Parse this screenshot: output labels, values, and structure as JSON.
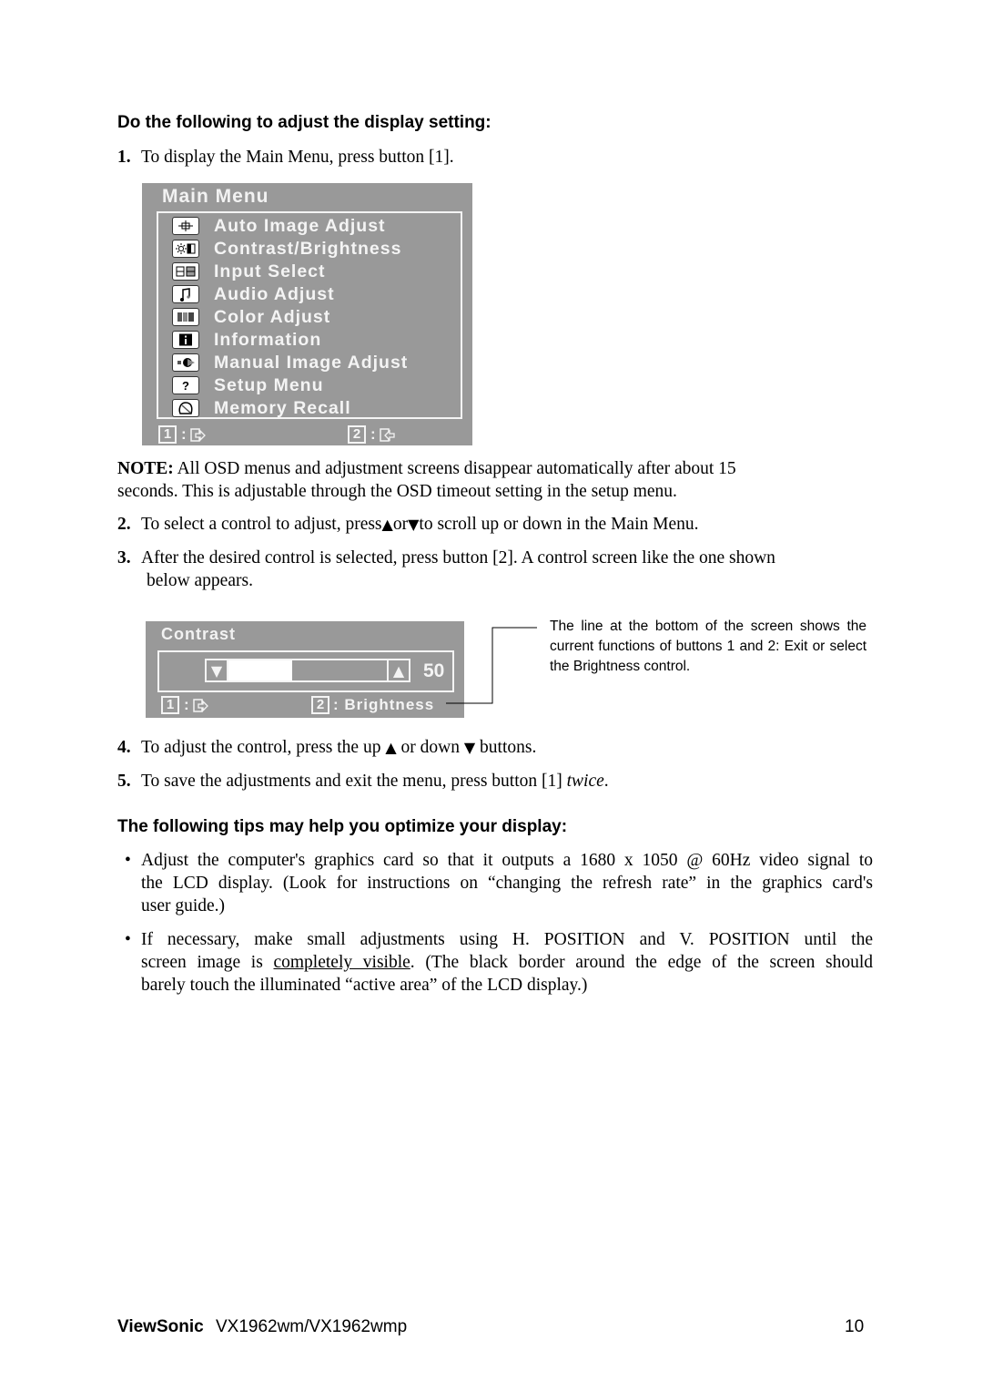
{
  "section_heading": "Do the following to adjust the display setting:",
  "steps": [
    {
      "num": "1.",
      "text": "To display the Main Menu, press button [1]."
    },
    {
      "num": "2.",
      "text_before": "To select a control to adjust, press",
      "up_symbol": "▲",
      "mid": "or",
      "down_symbol": "▼",
      "text_after": "to scroll up or down in the Main Menu."
    },
    {
      "num": "3.",
      "line1": "After the desired control is selected, press button [2]. A control screen like the one shown",
      "line2": "below appears."
    },
    {
      "num": "4.",
      "text_before": "To adjust the control, press the up",
      "up_symbol": "▲",
      "mid": "or down",
      "down_symbol": "▼",
      "text_after": "buttons."
    },
    {
      "num": "5.",
      "text": "To save the adjustments and exit the menu, press button [1]",
      "emphasis": "twice",
      "end": "."
    }
  ],
  "note": {
    "label": "NOTE:",
    "line1": "All OSD menus and adjustment screens disappear automatically after about 15",
    "line2": "seconds. This is adjustable through the OSD timeout setting in the setup menu."
  },
  "main_menu": {
    "title": "Main Menu",
    "items": [
      {
        "label": "Auto Image Adjust",
        "icon": "crosshair-icon",
        "glyph": "✥"
      },
      {
        "label": "Contrast/Brightness",
        "icon": "brightness-icon",
        "glyph": "☼▐"
      },
      {
        "label": "Input Select",
        "icon": "input-select-icon",
        "glyph": "⊟⊟"
      },
      {
        "label": "Audio Adjust",
        "icon": "music-note-icon",
        "glyph": "♫"
      },
      {
        "label": "Color Adjust",
        "icon": "color-bars-icon",
        "glyph": "▮▮"
      },
      {
        "label": "Information",
        "icon": "info-icon",
        "glyph": "i"
      },
      {
        "label": "Manual Image Adjust",
        "icon": "wrench-icon",
        "glyph": "▪◐"
      },
      {
        "label": "Setup Menu",
        "icon": "question-icon",
        "glyph": "?"
      },
      {
        "label": "Memory Recall",
        "icon": "memory-recall-icon",
        "glyph": "◯"
      }
    ],
    "footer": {
      "key1": "1",
      "sep": ":",
      "key2": "2"
    }
  },
  "contrast_screen": {
    "title": "Contrast",
    "value": "50",
    "level_percent": 50,
    "down_symbol": "▼",
    "up_symbol": "▲",
    "footer": {
      "key1": "1",
      "sep": ":",
      "key2": "2",
      "key2_label": ": Brightness"
    }
  },
  "callout_text": "The line at the bottom of the screen shows the current functions of buttons 1 and 2: Exit or select the Brightness control.",
  "tips_heading": "The following tips may help you optimize your display:",
  "tips": [
    {
      "bullet": "•",
      "line1": "Adjust the computer's graphics card so that it outputs a 1680 x 1050 @ 60Hz video signal to",
      "line2": "the LCD display. (Look for instructions on “changing the refresh rate” in the graphics card's",
      "line3": "user guide.)"
    },
    {
      "bullet": "•",
      "line1": "If necessary, make small adjustments using H. POSITION and V. POSITION until the",
      "line2_before": "screen image is ",
      "line2_link": "completely visible",
      "line2_after": ". (The black border around the edge of the screen should",
      "line3": "barely touch the illuminated “active area” of the LCD display.)"
    }
  ],
  "footer": {
    "brand": "ViewSonic",
    "model": "VX1962wm/VX1962wmp",
    "page_number": "10"
  }
}
